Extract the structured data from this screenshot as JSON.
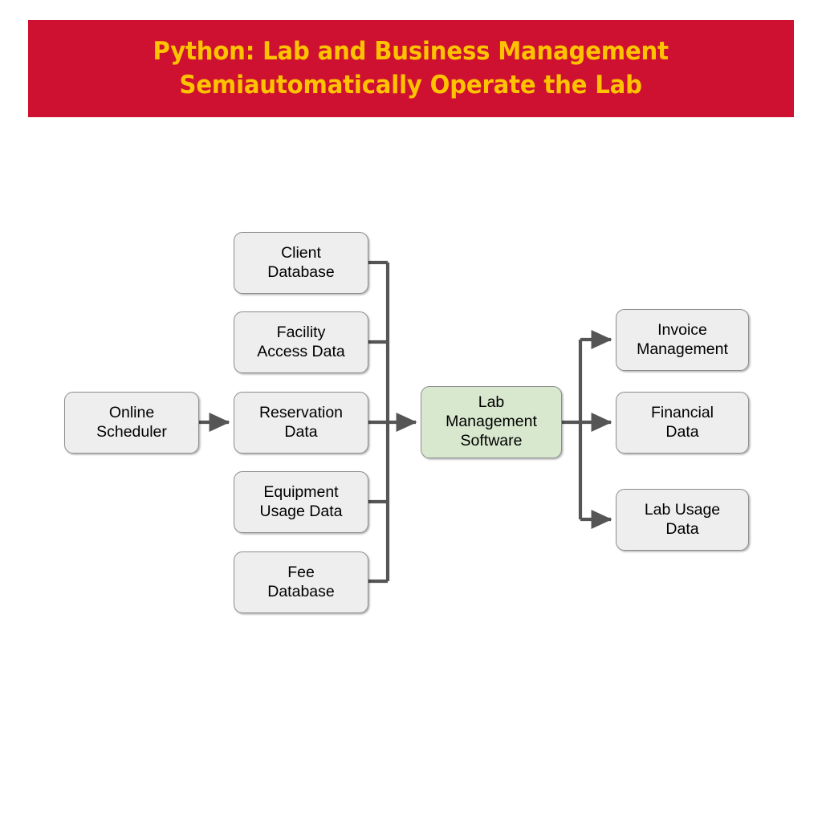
{
  "banner": {
    "title_line1": "Python: Lab and Business Management",
    "title_line2": "Semiautomatically Operate the Lab",
    "title_full": "Python: Lab and Business Management\nSemiautomatically Operate the Lab",
    "background_color": "#ce1130",
    "text_color": "#fdc300"
  },
  "diagram": {
    "type": "flowchart",
    "node_fill_default": "#eeeeee",
    "node_fill_highlight": "#d8e8ce",
    "node_border_color": "#8d8d8d",
    "connector_color": "#555555",
    "source": {
      "label": "Online\nScheduler",
      "name": "online-scheduler"
    },
    "inputs": [
      {
        "name": "client-database",
        "label": "Client\nDatabase"
      },
      {
        "name": "facility-access-data",
        "label": "Facility\nAccess Data"
      },
      {
        "name": "reservation-data",
        "label": "Reservation\nData"
      },
      {
        "name": "equipment-usage-data",
        "label": "Equipment\nUsage Data"
      },
      {
        "name": "fee-database",
        "label": "Fee\nDatabase"
      }
    ],
    "hub": {
      "name": "lab-management-software",
      "label": "Lab\nManagement\nSoftware"
    },
    "outputs": [
      {
        "name": "invoice-management",
        "label": "Invoice\nManagement"
      },
      {
        "name": "financial-data",
        "label": "Financial\nData"
      },
      {
        "name": "lab-usage-data",
        "label": "Lab Usage\nData"
      }
    ]
  }
}
